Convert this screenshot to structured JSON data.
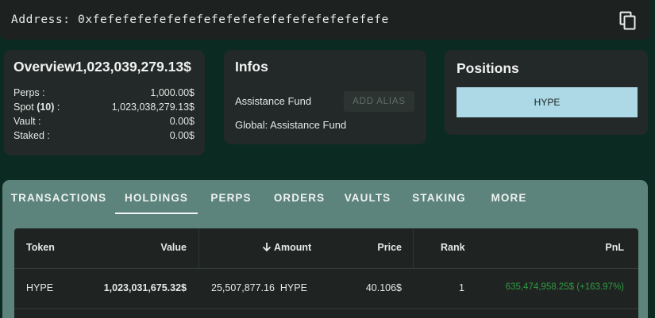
{
  "address": {
    "label": "Address:",
    "value": "0xfefefefefefefefefefefefefefefefefefefefe",
    "copy_icon": "copy-icon"
  },
  "overview": {
    "title": "Overview1,023,039,279.13$",
    "rows": [
      {
        "label": "Perps :",
        "value": "1,000.00$"
      },
      {
        "label_prefix": "Spot ",
        "label_count": "(10)",
        "label_suffix": " :",
        "value": "1,023,038,279.13$"
      },
      {
        "label": "Vault :",
        "value": "0.00$"
      },
      {
        "label": "Staked :",
        "value": "0.00$"
      }
    ]
  },
  "infos": {
    "title": "Infos",
    "name": "Assistance Fund",
    "add_alias_label": "ADD ALIAS",
    "global": "Global: Assistance Fund"
  },
  "positions": {
    "title": "Positions",
    "items": [
      {
        "label": "HYPE"
      }
    ]
  },
  "tabs": {
    "items": [
      "TRANSACTIONS",
      "HOLDINGS",
      "PERPS",
      "ORDERS",
      "VAULTS",
      "STAKING",
      "MORE"
    ],
    "active": "HOLDINGS"
  },
  "holdings": {
    "columns": {
      "token": "Token",
      "value": "Value",
      "amount": "Amount",
      "amount_sort_icon": "arrow-down-icon",
      "price": "Price",
      "rank": "Rank",
      "pnl": "PnL"
    },
    "rows": [
      {
        "token": "HYPE",
        "value": "1,023,031,675.32$",
        "amount": "25,507,877.16",
        "amount_unit": "HYPE",
        "price": "40.106$",
        "rank": "1",
        "pnl": "635,474,958.25$",
        "pnl_pct": "(+163.97%)"
      }
    ]
  },
  "colors": {
    "background": "#0b2a22",
    "card": "#232928",
    "tab_bar": "#5d847c",
    "position_chip": "#add8e6",
    "pnl_positive": "#2e9a3e"
  }
}
